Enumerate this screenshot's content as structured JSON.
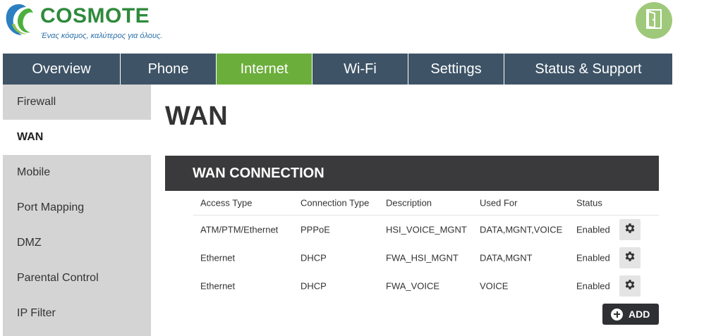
{
  "header": {
    "brand": "COSMOTE",
    "tagline": "Ένας κόσμος, καλύτερος για όλους.",
    "logout_icon": "door-exit-icon",
    "brand_color": "#2f8a3c",
    "logout_bg": "#9fc97a"
  },
  "nav": {
    "tabs": [
      {
        "label": "Overview"
      },
      {
        "label": "Phone"
      },
      {
        "label": "Internet",
        "active": true
      },
      {
        "label": "Wi-Fi"
      },
      {
        "label": "Settings"
      },
      {
        "label": "Status & Support"
      }
    ],
    "bg_color": "#3e5366",
    "active_color": "#6cae3b"
  },
  "sidebar": {
    "items": [
      {
        "label": "Firewall"
      },
      {
        "label": "WAN",
        "active": true
      },
      {
        "label": "Mobile"
      },
      {
        "label": "Port Mapping"
      },
      {
        "label": "DMZ"
      },
      {
        "label": "Parental Control"
      },
      {
        "label": "IP Filter"
      }
    ]
  },
  "page": {
    "title": "WAN",
    "section_title": "WAN CONNECTION"
  },
  "table": {
    "headers": [
      "Access Type",
      "Connection Type",
      "Description",
      "Used For",
      "Status"
    ],
    "rows": [
      {
        "access_type": "ATM/PTM/Ethernet",
        "connection_type": "PPPoE",
        "description": "HSI_VOICE_MGNT",
        "used_for": "DATA,MGNT,VOICE",
        "status": "Enabled",
        "action_icon": "gear-icon"
      },
      {
        "access_type": "Ethernet",
        "connection_type": "DHCP",
        "description": "FWA_HSI_MGNT",
        "used_for": "DATA,MGNT",
        "status": "Enabled",
        "action_icon": "gear-icon"
      },
      {
        "access_type": "Ethernet",
        "connection_type": "DHCP",
        "description": "FWA_VOICE",
        "used_for": "VOICE",
        "status": "Enabled",
        "action_icon": "gear-icon"
      }
    ]
  },
  "actions": {
    "add_label": "ADD",
    "add_icon": "plus-circle-icon"
  }
}
